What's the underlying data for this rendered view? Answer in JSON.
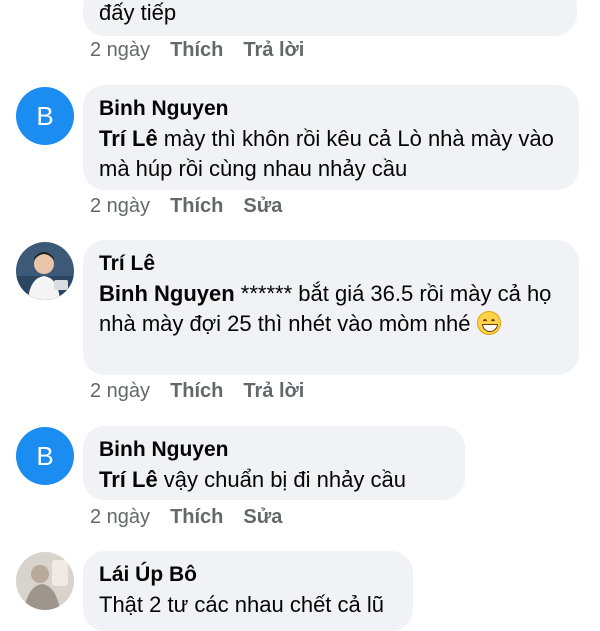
{
  "comments": [
    {
      "text_tail": "đấy tiếp",
      "time": "2 ngày",
      "like": "Thích",
      "action": "Trả lời"
    },
    {
      "avatar_letter": "B",
      "author": "Binh Nguyen",
      "mention": "Trí Lê",
      "text": "  mày thì khôn rồi kêu cả Lò nhà mày vào mà húp rồi cùng nhau nhảy cầu",
      "time": "2 ngày",
      "like": "Thích",
      "action": "Sửa"
    },
    {
      "author": "Trí Lê",
      "mention": "Binh Nguyen",
      "text": "  ****** bắt giá 36.5 rồi mày cả họ nhà mày đợi 25 thì nhét vào mòm nhé",
      "time": "2 ngày",
      "like": "Thích",
      "action": "Trả lời"
    },
    {
      "avatar_letter": "B",
      "author": "Binh Nguyen",
      "mention": "Trí Lê",
      "text": "  vậy chuẩn bị đi nhảy cầu",
      "time": "2 ngày",
      "like": "Thích",
      "action": "Sửa"
    },
    {
      "author": "Lái Úp Bô",
      "text_partial": "Thật 2 tư các nhau chết cả lũ"
    }
  ],
  "colors": {
    "bubble": "#f0f2f5",
    "avatar_blue": "#1b8cf0",
    "meta_gray": "#65676b"
  }
}
